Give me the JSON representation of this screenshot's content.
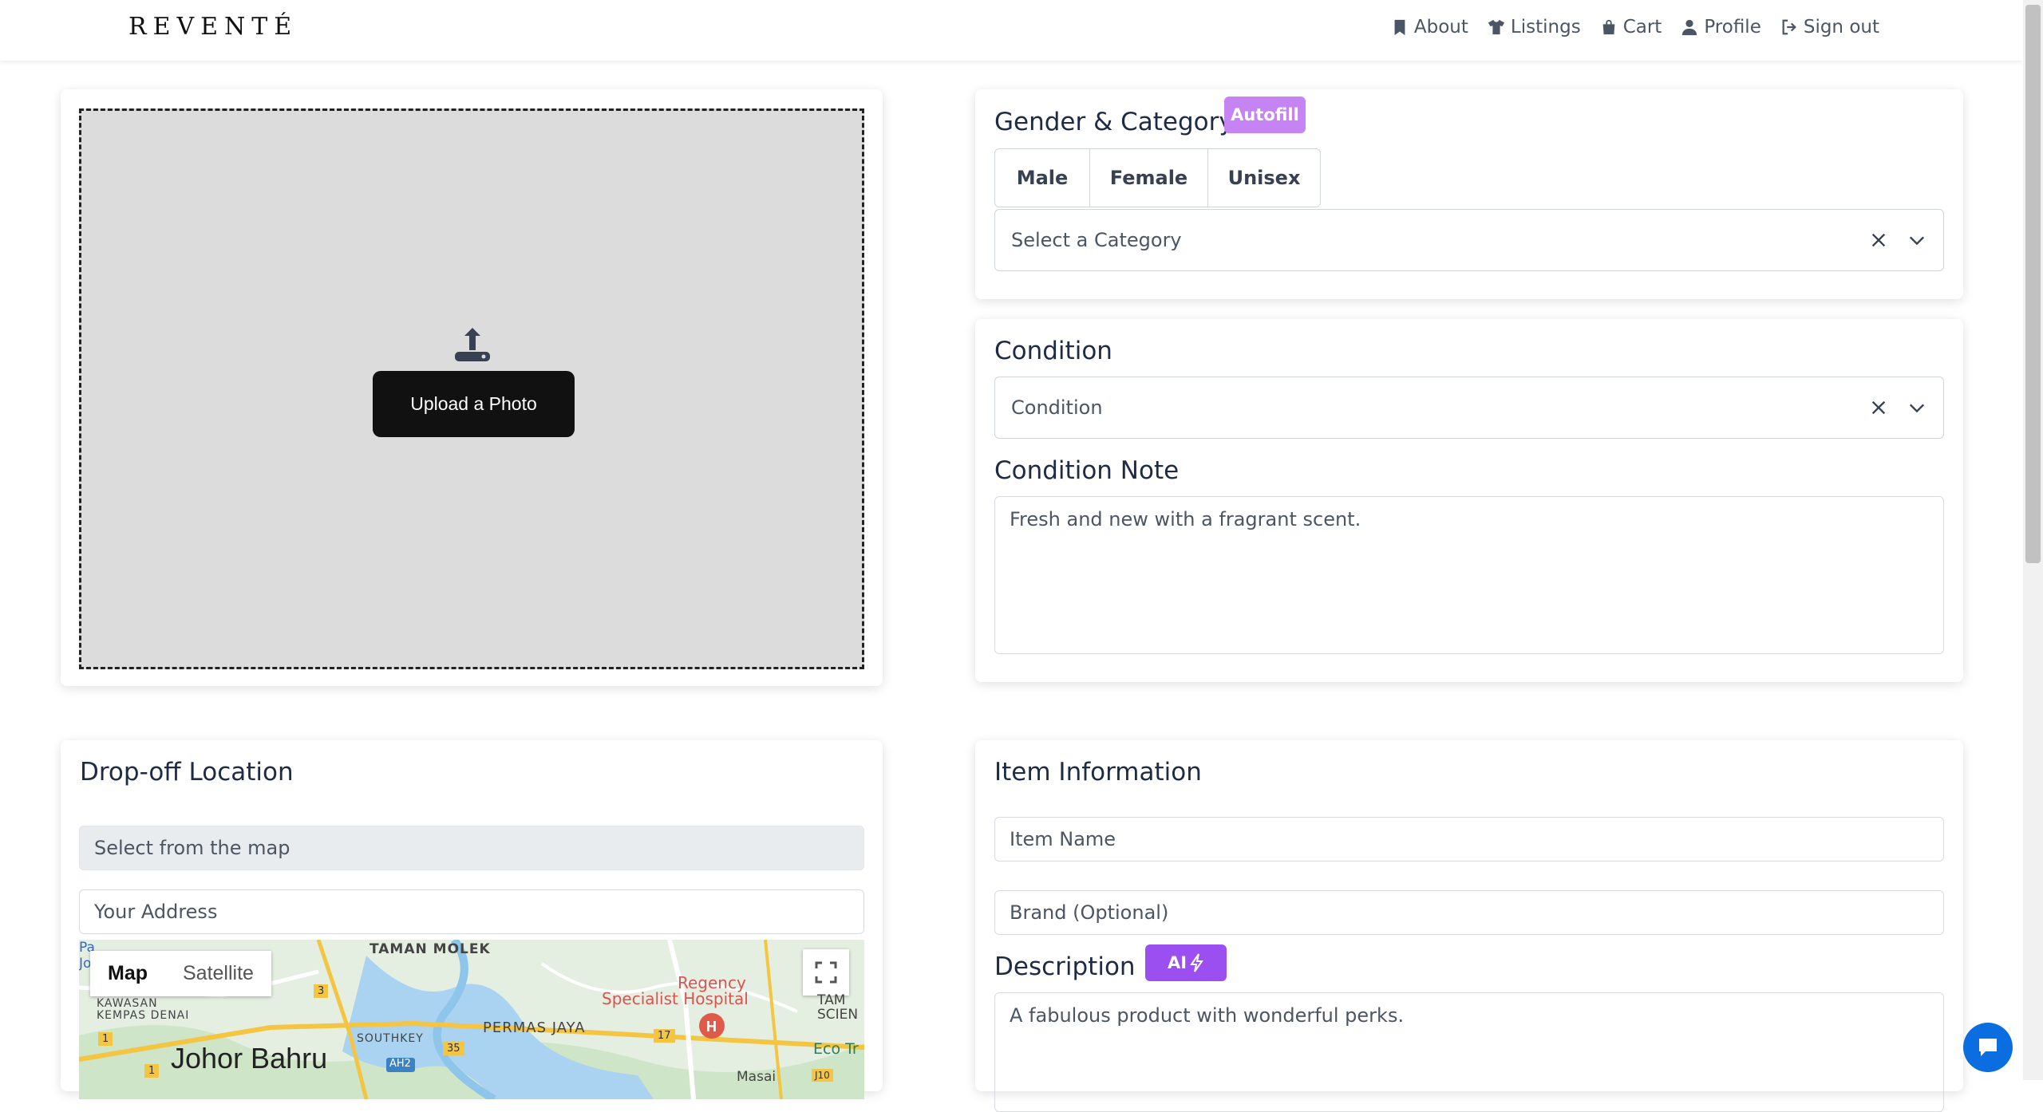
{
  "brand": "REVENTÉ",
  "nav": [
    {
      "label": "About",
      "icon": "bookmark-icon"
    },
    {
      "label": "Listings",
      "icon": "shirt-icon"
    },
    {
      "label": "Cart",
      "icon": "bag-icon"
    },
    {
      "label": "Profile",
      "icon": "user-icon"
    },
    {
      "label": "Sign out",
      "icon": "sign-out-icon"
    }
  ],
  "upload": {
    "button_label": "Upload a Photo"
  },
  "gender": {
    "title": "Gender & Category",
    "autofill_label": "Autofill",
    "options": [
      "Male",
      "Female",
      "Unisex"
    ],
    "category_placeholder": "Select a Category"
  },
  "condition": {
    "title": "Condition",
    "placeholder": "Condition",
    "note_title": "Condition Note",
    "note_value": "Fresh and new with a fragrant scent."
  },
  "location": {
    "title": "Drop-off Location",
    "map_select_placeholder": "Select from the map",
    "address_placeholder": "Your Address",
    "map_tabs": [
      "Map",
      "Satellite"
    ],
    "map_labels": {
      "taman_molek": "TAMAN MOLEK",
      "regency": "Regency",
      "specialist": "Specialist Hospital",
      "kawasan": "KAWASAN",
      "kempas": "KEMPAS DENAI",
      "southkey": "SOUTHKEY",
      "permas": "PERMAS JAYA",
      "johor": "Johor Bahru",
      "tam": "TAM",
      "scien": "SCIEN",
      "eco": "Eco Tr",
      "ah2": "AH2",
      "r3": "3",
      "r35": "35",
      "r17": "17",
      "r1": "1",
      "r1b": "1",
      "j10": "J10",
      "pa": "Pa",
      "jo": "Jo",
      "masai": "Masai"
    }
  },
  "item": {
    "title": "Item Information",
    "name_placeholder": "Item Name",
    "brand_placeholder": "Brand (Optional)",
    "description_title": "Description",
    "ai_label": "AI",
    "description_value": "A fabulous product with wonderful perks."
  },
  "colors": {
    "accent_purple": "#9b4ff0",
    "autofill_purple": "#c683f4",
    "chat_blue": "#0b6ee0"
  }
}
